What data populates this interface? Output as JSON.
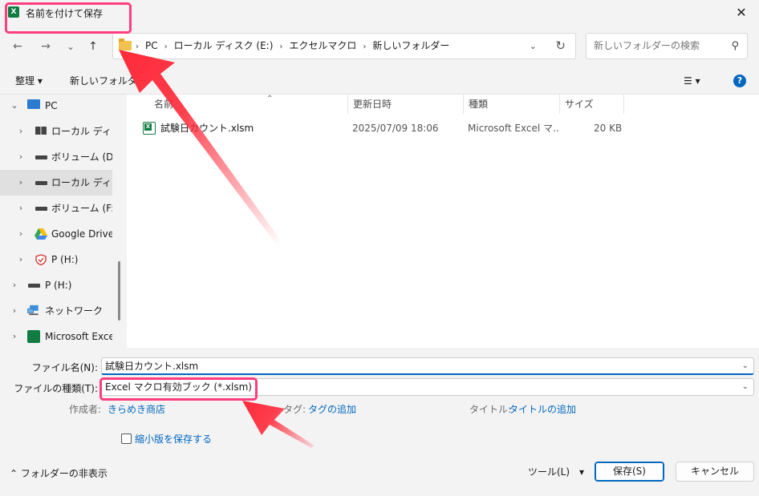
{
  "window": {
    "app_icon": "X",
    "title": "名前を付けて保存",
    "close": "✕"
  },
  "nav": {
    "back": "←",
    "forward": "→",
    "recent": "⌄",
    "up": "↑",
    "breadcrumbs": [
      "PC",
      "ローカル ディスク (E:)",
      "エクセルマクロ",
      "新しいフォルダー"
    ],
    "crumb_sep": "›",
    "dropdown": "⌄",
    "refresh": "↻",
    "search_placeholder": "新しいフォルダーの検索",
    "search_icon": "⚲"
  },
  "toolbar": {
    "organize": "整理 ▾",
    "new_folder": "新しいフォルダー",
    "view": "☰ ▾",
    "help": "?"
  },
  "sidebar": {
    "items": [
      {
        "label": "PC",
        "chevron": "⌄",
        "icon": "computer-icon"
      },
      {
        "label": "ローカル ディスク",
        "chevron": "›",
        "icon": "windows-drive-icon"
      },
      {
        "label": "ボリューム (D:)",
        "chevron": "›",
        "icon": "drive-icon"
      },
      {
        "label": "ローカル ディスク",
        "chevron": "›",
        "icon": "drive-icon"
      },
      {
        "label": "ボリューム (F:)",
        "chevron": "›",
        "icon": "drive-icon"
      },
      {
        "label": "Google Drive (",
        "chevron": "›",
        "icon": "google-drive-icon"
      },
      {
        "label": "P (H:)",
        "chevron": "›",
        "icon": "shield-drive-icon"
      },
      {
        "label": "P (H:)",
        "chevron": "›",
        "icon": "drive-icon"
      },
      {
        "label": "ネットワーク",
        "chevron": "›",
        "icon": "network-icon"
      },
      {
        "label": "Microsoft Excel",
        "chevron": "›",
        "icon": "excel-icon"
      }
    ]
  },
  "files": {
    "sort_arrow": "⌃",
    "columns": [
      "名前",
      "更新日時",
      "種類",
      "サイズ"
    ],
    "rows": [
      {
        "name": "試験日カウント.xlsm",
        "modified": "2025/07/09 18:06",
        "type": "Microsoft Excel マ...",
        "size": "20 KB"
      }
    ]
  },
  "form": {
    "filename_label": "ファイル名(N):",
    "filename_value": "試験日カウント.xlsm",
    "filetype_label": "ファイルの種類(T):",
    "filetype_value": "Excel マクロ有効ブック (*.xlsm)",
    "dropdown": "⌄",
    "author_label": "作成者:",
    "author_value": "きらめき商店",
    "tags_label": "タグ:",
    "tags_value": "タグの追加",
    "title_label": "タイトル:",
    "title_value": "タイトルの追加",
    "thumbnail_label": "縮小版を保存する",
    "hide_folders": "⌃ フォルダーの非表示",
    "tools": "ツール(L)　▾",
    "save": "保存(S)",
    "cancel": "キャンセル"
  },
  "colors": {
    "highlight": "#ff3d7f",
    "arrow": "#ff2a3a",
    "accent": "#0067c0",
    "excel_green": "#107c41"
  }
}
